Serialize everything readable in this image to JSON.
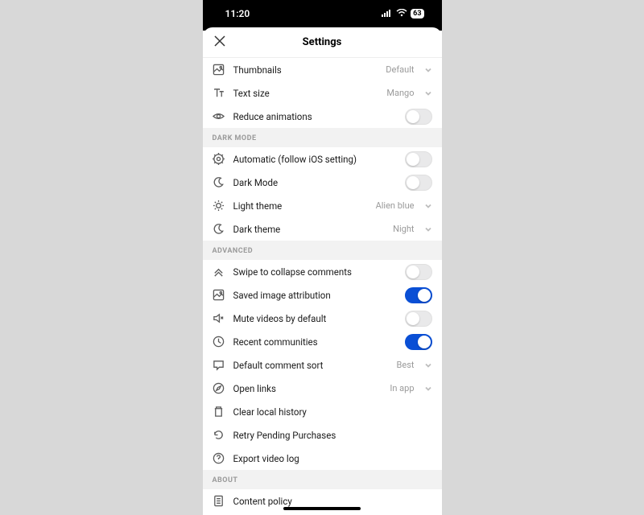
{
  "status": {
    "time": "11:20",
    "battery": "63"
  },
  "header": {
    "title": "Settings"
  },
  "rows": {
    "thumbnails": {
      "label": "Thumbnails",
      "value": "Default"
    },
    "textsize": {
      "label": "Text size",
      "value": "Mango"
    },
    "reduceanim": {
      "label": "Reduce animations",
      "on": false
    },
    "auto_ios": {
      "label": "Automatic (follow iOS setting)",
      "on": false
    },
    "dark_mode": {
      "label": "Dark Mode",
      "on": false
    },
    "light_theme": {
      "label": "Light theme",
      "value": "Alien blue"
    },
    "dark_theme": {
      "label": "Dark theme",
      "value": "Night"
    },
    "swipe_collapse": {
      "label": "Swipe to collapse comments",
      "on": false
    },
    "saved_attr": {
      "label": "Saved image attribution",
      "on": true
    },
    "mute_default": {
      "label": "Mute videos by default",
      "on": false
    },
    "recent_comm": {
      "label": "Recent communities",
      "on": true
    },
    "default_sort": {
      "label": "Default comment sort",
      "value": "Best"
    },
    "open_links": {
      "label": "Open links",
      "value": "In app"
    },
    "clear_history": {
      "label": "Clear local history"
    },
    "retry_purchases": {
      "label": "Retry Pending Purchases"
    },
    "export_video": {
      "label": "Export video log"
    },
    "content_policy": {
      "label": "Content policy"
    }
  },
  "sections": {
    "dark_mode": "DARK MODE",
    "advanced": "ADVANCED",
    "about": "ABOUT"
  }
}
